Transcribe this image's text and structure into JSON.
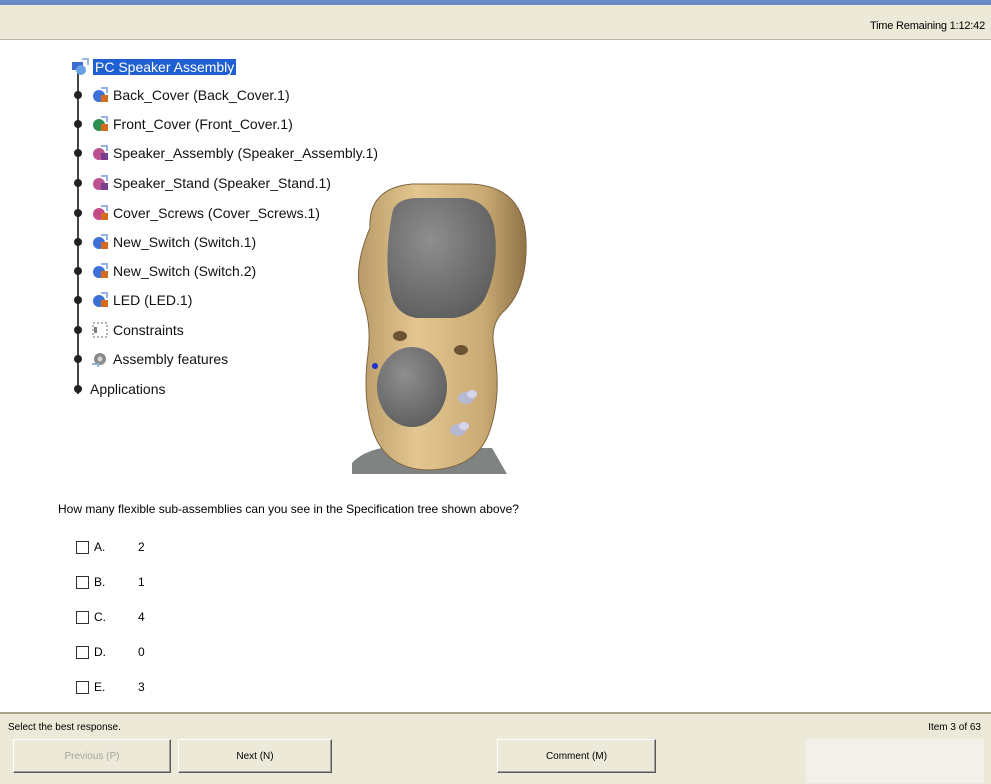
{
  "header": {
    "time_remaining": "Time Remaining 1:12:42"
  },
  "tree": {
    "root": "PC Speaker Assembly",
    "items": [
      "Back_Cover (Back_Cover.1)",
      "Front_Cover (Front_Cover.1)",
      "Speaker_Assembly (Speaker_Assembly.1)",
      "Speaker_Stand (Speaker_Stand.1)",
      "Cover_Screws (Cover_Screws.1)",
      "New_Switch (Switch.1)",
      "New_Switch (Switch.2)",
      "LED (LED.1)",
      "Constraints",
      "Assembly features",
      "Applications"
    ]
  },
  "question": {
    "text": "How many flexible sub-assemblies can you see in the Specification tree shown above?",
    "options": [
      {
        "letter": "A.",
        "value": "2"
      },
      {
        "letter": "B.",
        "value": "1"
      },
      {
        "letter": "C.",
        "value": "4"
      },
      {
        "letter": "D.",
        "value": "0"
      },
      {
        "letter": "E.",
        "value": "3"
      }
    ]
  },
  "footer": {
    "instruction": "Select the best response.",
    "item_count": "Item 3 of 63",
    "previous_label": "Previous (P)",
    "next_label": "Next (N)",
    "comment_label": "Comment (M)"
  }
}
